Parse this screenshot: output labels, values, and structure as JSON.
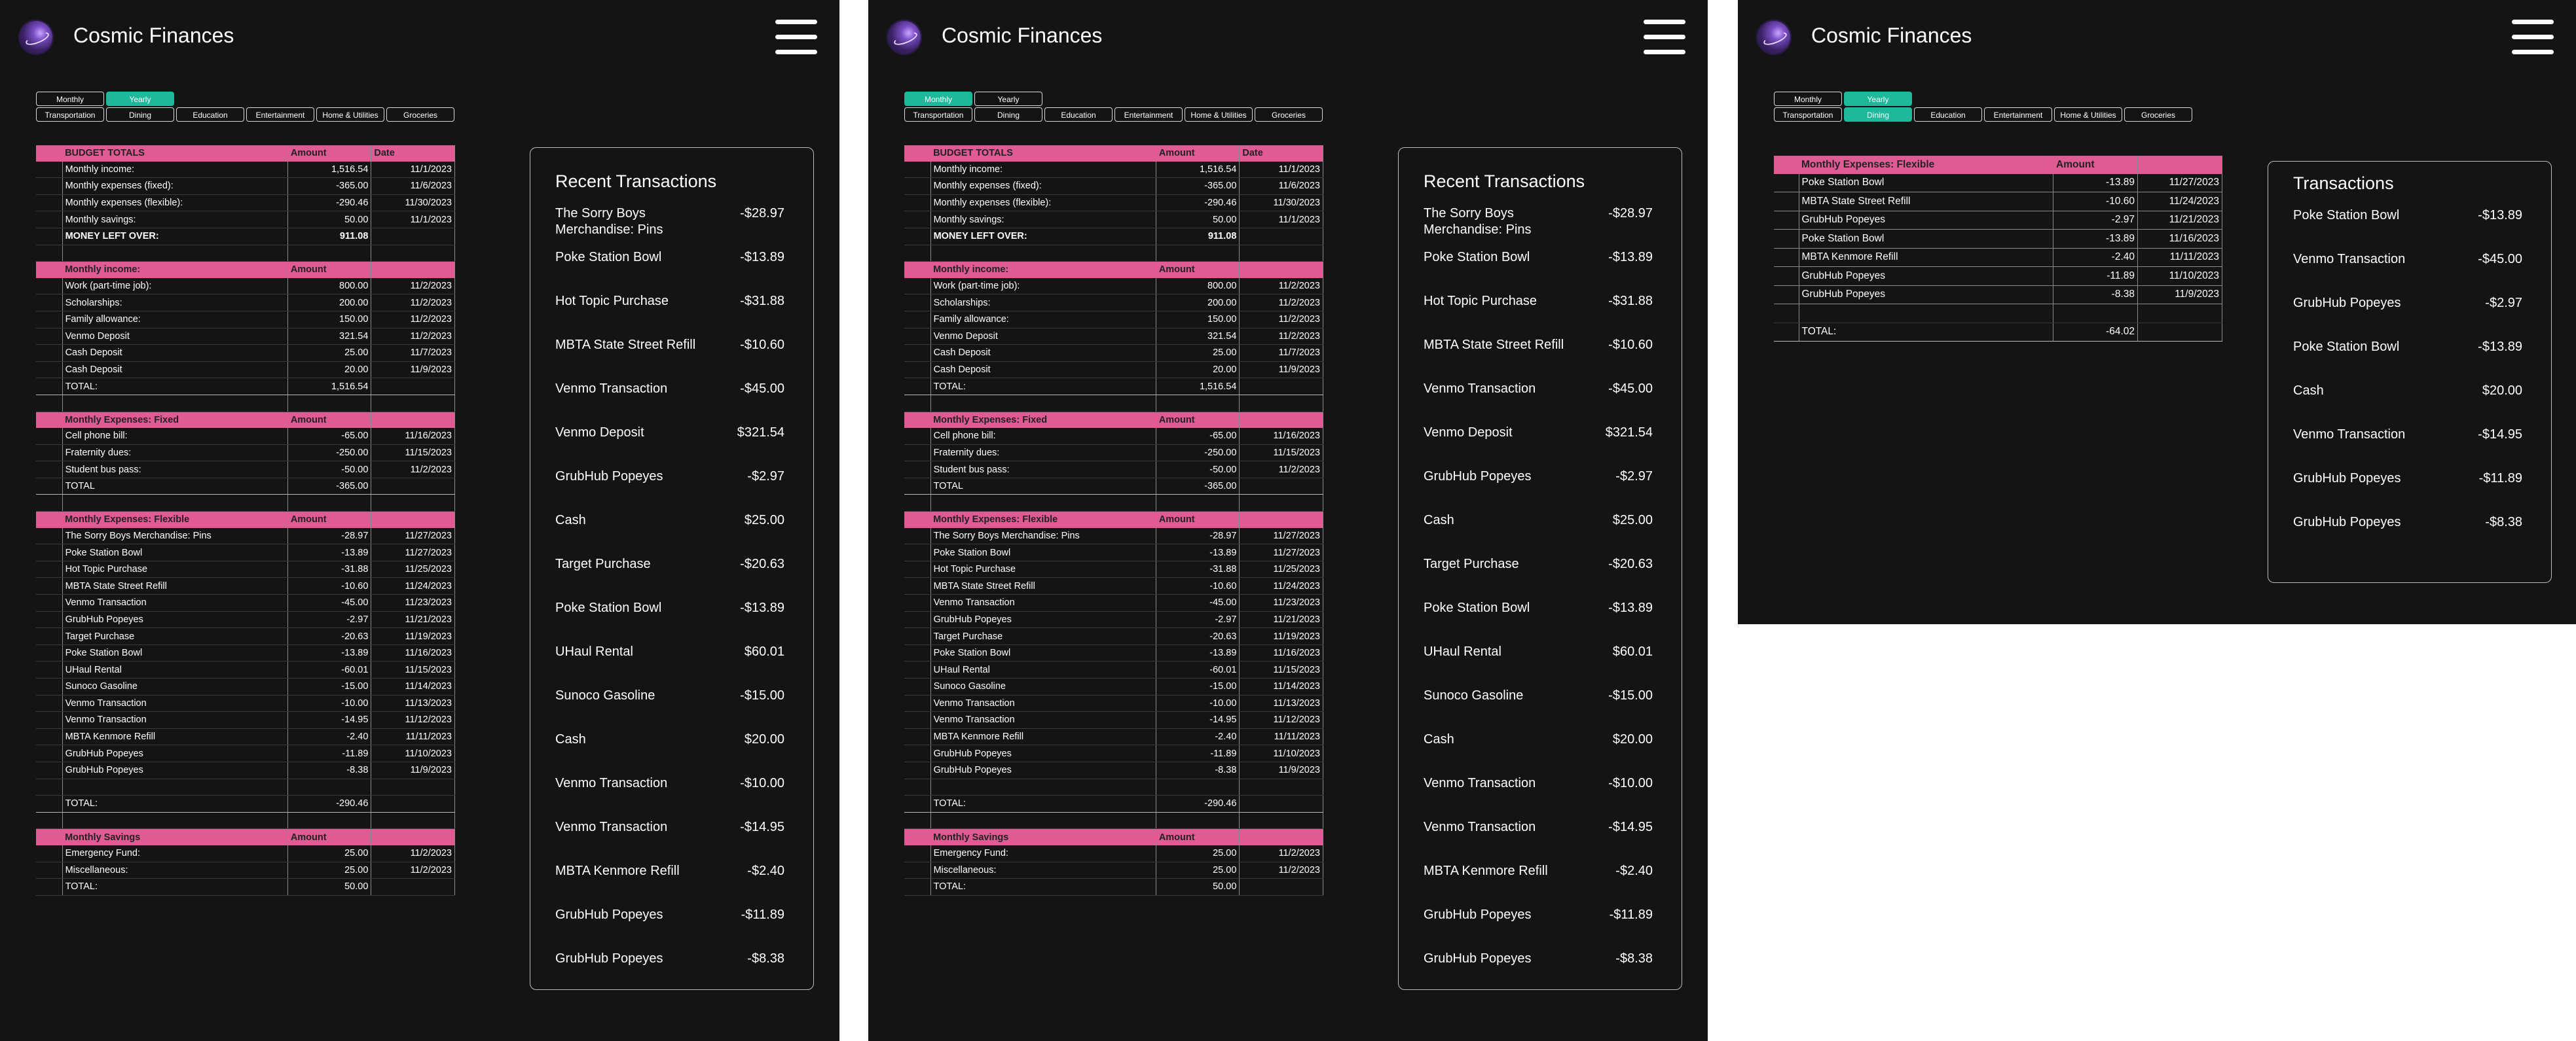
{
  "app": {
    "title": "Cosmic Finances"
  },
  "screens": [
    {
      "tabs": {
        "row1": [
          {
            "label": "Monthly",
            "active": false
          },
          {
            "label": "Yearly",
            "active": true
          }
        ],
        "row2": [
          {
            "label": "Transportation",
            "active": false
          },
          {
            "label": "Dining",
            "active": false
          },
          {
            "label": "Education",
            "active": false
          },
          {
            "label": "Entertainment",
            "active": false
          },
          {
            "label": "Home & Utilities",
            "active": false
          },
          {
            "label": "Groceries",
            "active": false
          }
        ]
      }
    },
    {
      "tabs": {
        "row1": [
          {
            "label": "Monthly",
            "active": true
          },
          {
            "label": "Yearly",
            "active": false
          }
        ],
        "row2": [
          {
            "label": "Transportation",
            "active": false
          },
          {
            "label": "Dining",
            "active": false
          },
          {
            "label": "Education",
            "active": false
          },
          {
            "label": "Entertainment",
            "active": false
          },
          {
            "label": "Home & Utilities",
            "active": false
          },
          {
            "label": "Groceries",
            "active": false
          }
        ]
      }
    },
    {
      "tabs": {
        "row1": [
          {
            "label": "Monthly",
            "active": false
          },
          {
            "label": "Yearly",
            "active": true
          }
        ],
        "row2": [
          {
            "label": "Transportation",
            "active": false
          },
          {
            "label": "Dining",
            "active": true
          },
          {
            "label": "Education",
            "active": false
          },
          {
            "label": "Entertainment",
            "active": false
          },
          {
            "label": "Home & Utilities",
            "active": false
          },
          {
            "label": "Groceries",
            "active": false
          }
        ]
      }
    }
  ],
  "budget_sheet": [
    [
      "hdr",
      "BUDGET TOTALS",
      "Amount",
      "Date"
    ],
    [
      "row",
      "Monthly income:",
      "1,516.54",
      "11/1/2023"
    ],
    [
      "row",
      "Monthly expenses (fixed):",
      "-365.00",
      "11/6/2023"
    ],
    [
      "row",
      "Monthly expenses (flexible):",
      "-290.46",
      "11/30/2023"
    ],
    [
      "row",
      "Monthly savings:",
      "50.00",
      "11/1/2023"
    ],
    [
      "bold",
      "MONEY LEFT OVER:",
      "911.08",
      ""
    ],
    [
      "blank",
      "",
      "",
      ""
    ],
    [
      "hdr",
      "Monthly income:",
      "Amount",
      ""
    ],
    [
      "row",
      "Work (part-time job):",
      "800.00",
      "11/2/2023"
    ],
    [
      "row",
      "Scholarships:",
      "200.00",
      "11/2/2023"
    ],
    [
      "row",
      "Family allowance:",
      "150.00",
      "11/2/2023"
    ],
    [
      "row",
      "Venmo Deposit",
      "321.54",
      "11/2/2023"
    ],
    [
      "row",
      "Cash Deposit",
      "25.00",
      "11/7/2023"
    ],
    [
      "row",
      "Cash Deposit",
      "20.00",
      "11/9/2023"
    ],
    [
      "tot",
      "TOTAL:",
      "1,516.54",
      ""
    ],
    [
      "blank",
      "",
      "",
      ""
    ],
    [
      "hdr",
      "Monthly Expenses: Fixed",
      "Amount",
      ""
    ],
    [
      "row",
      "Cell phone bill:",
      "-65.00",
      "11/16/2023"
    ],
    [
      "row",
      "Fraternity dues:",
      "-250.00",
      "11/15/2023"
    ],
    [
      "row",
      "Student bus pass:",
      "-50.00",
      "11/2/2023"
    ],
    [
      "tot",
      "TOTAL",
      "-365.00",
      ""
    ],
    [
      "blank",
      "",
      "",
      ""
    ],
    [
      "hdr",
      "Monthly Expenses: Flexible",
      "Amount",
      ""
    ],
    [
      "row",
      "The Sorry Boys Merchandise: Pins",
      "-28.97",
      "11/27/2023"
    ],
    [
      "row",
      "Poke Station Bowl",
      "-13.89",
      "11/27/2023"
    ],
    [
      "row",
      "Hot Topic Purchase",
      "-31.88",
      "11/25/2023"
    ],
    [
      "row",
      "MBTA State Street Refill",
      "-10.60",
      "11/24/2023"
    ],
    [
      "row",
      "Venmo Transaction",
      "-45.00",
      "11/23/2023"
    ],
    [
      "row",
      "GrubHub Popeyes",
      "-2.97",
      "11/21/2023"
    ],
    [
      "row",
      "Target Purchase",
      "-20.63",
      "11/19/2023"
    ],
    [
      "row",
      "Poke Station Bowl",
      "-13.89",
      "11/16/2023"
    ],
    [
      "row",
      "UHaul Rental",
      "-60.01",
      "11/15/2023"
    ],
    [
      "row",
      "Sunoco Gasoline",
      "-15.00",
      "11/14/2023"
    ],
    [
      "row",
      "Venmo Transaction",
      "-10.00",
      "11/13/2023"
    ],
    [
      "row",
      "Venmo Transaction",
      "-14.95",
      "11/12/2023"
    ],
    [
      "row",
      "MBTA Kenmore Refill",
      "-2.40",
      "11/11/2023"
    ],
    [
      "row",
      "GrubHub Popeyes",
      "-11.89",
      "11/10/2023"
    ],
    [
      "row",
      "GrubHub Popeyes",
      "-8.38",
      "11/9/2023"
    ],
    [
      "blank",
      "",
      "",
      ""
    ],
    [
      "tot",
      "TOTAL:",
      "-290.46",
      ""
    ],
    [
      "blank",
      "",
      "",
      ""
    ],
    [
      "hdr",
      "Monthly Savings",
      "Amount",
      ""
    ],
    [
      "row",
      "Emergency Fund:",
      "25.00",
      "11/2/2023"
    ],
    [
      "row",
      "Miscellaneous:",
      "25.00",
      "11/2/2023"
    ],
    [
      "row",
      "TOTAL:",
      "50.00",
      ""
    ]
  ],
  "dining_sheet": [
    [
      "hdr",
      "Monthly Expenses: Flexible",
      "Amount",
      ""
    ],
    [
      "row",
      "Poke Station Bowl",
      "-13.89",
      "11/27/2023"
    ],
    [
      "row",
      "MBTA State Street Refill",
      "-10.60",
      "11/24/2023"
    ],
    [
      "row",
      "GrubHub Popeyes",
      "-2.97",
      "11/21/2023"
    ],
    [
      "row",
      "Poke Station Bowl",
      "-13.89",
      "11/16/2023"
    ],
    [
      "row",
      "MBTA Kenmore Refill",
      "-2.40",
      "11/11/2023"
    ],
    [
      "row",
      "GrubHub Popeyes",
      "-11.89",
      "11/10/2023"
    ],
    [
      "row",
      "GrubHub Popeyes",
      "-8.38",
      "11/9/2023"
    ],
    [
      "blank",
      "",
      "",
      ""
    ],
    [
      "tot",
      "TOTAL:",
      "-64.02",
      ""
    ]
  ],
  "recent_transactions": {
    "title": "Recent Transactions",
    "items": [
      {
        "name": "The Sorry Boys Merchandise: Pins",
        "amount": "-$28.97"
      },
      {
        "name": "Poke Station Bowl",
        "amount": "-$13.89"
      },
      {
        "name": "Hot Topic Purchase",
        "amount": "-$31.88"
      },
      {
        "name": "MBTA State Street Refill",
        "amount": "-$10.60"
      },
      {
        "name": "Venmo Transaction",
        "amount": "-$45.00"
      },
      {
        "name": "Venmo Deposit",
        "amount": "$321.54"
      },
      {
        "name": "GrubHub Popeyes",
        "amount": "-$2.97"
      },
      {
        "name": "Cash",
        "amount": "$25.00"
      },
      {
        "name": "Target Purchase",
        "amount": "-$20.63"
      },
      {
        "name": "Poke Station Bowl",
        "amount": "-$13.89"
      },
      {
        "name": "UHaul Rental",
        "amount": "$60.01"
      },
      {
        "name": "Sunoco Gasoline",
        "amount": "-$15.00"
      },
      {
        "name": "Cash",
        "amount": "$20.00"
      },
      {
        "name": "Venmo Transaction",
        "amount": "-$10.00"
      },
      {
        "name": "Venmo Transaction",
        "amount": "-$14.95"
      },
      {
        "name": "MBTA Kenmore Refill",
        "amount": "-$2.40"
      },
      {
        "name": "GrubHub Popeyes",
        "amount": "-$11.89"
      },
      {
        "name": "GrubHub Popeyes",
        "amount": "-$8.38"
      }
    ]
  },
  "dining_transactions": {
    "title": "Transactions",
    "items": [
      {
        "name": "Poke Station Bowl",
        "amount": "-$13.89"
      },
      {
        "name": "Venmo Transaction",
        "amount": "-$45.00"
      },
      {
        "name": "GrubHub Popeyes",
        "amount": "-$2.97"
      },
      {
        "name": "Poke Station Bowl",
        "amount": "-$13.89"
      },
      {
        "name": "Cash",
        "amount": "$20.00"
      },
      {
        "name": "Venmo Transaction",
        "amount": "-$14.95"
      },
      {
        "name": "GrubHub Popeyes",
        "amount": "-$11.89"
      },
      {
        "name": "GrubHub Popeyes",
        "amount": "-$8.38"
      }
    ]
  },
  "colors": {
    "accent": "#1db99a",
    "header_pink": "#e05a94",
    "background": "#141414"
  }
}
